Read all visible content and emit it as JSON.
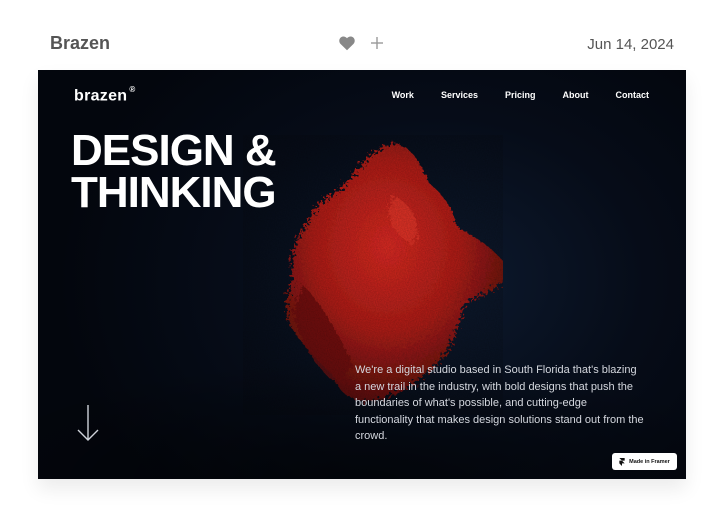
{
  "card": {
    "title": "Brazen",
    "date": "Jun 14, 2024",
    "icons": [
      "heart-icon",
      "plus-icon"
    ]
  },
  "website": {
    "logo": "brazen",
    "logo_mark": "®",
    "nav": [
      "Work",
      "Services",
      "Pricing",
      "About",
      "Contact"
    ],
    "headline": [
      "DESIGN &",
      "THINKING"
    ],
    "description": "We're a digital studio based in South Florida that's blazing a new trail in the industry, with bold designs that push the boundaries of what's possible, and cutting-edge functionality that makes design solutions stand out from the crowd.",
    "scroll_icon": "arrow-down-icon",
    "badge": "Made in Framer"
  },
  "colors": {
    "header_text": "#555555",
    "icon_gray": "#888888",
    "site_bg": "#060c18",
    "blob_red": "#c8221c",
    "site_text": "#ffffff"
  }
}
